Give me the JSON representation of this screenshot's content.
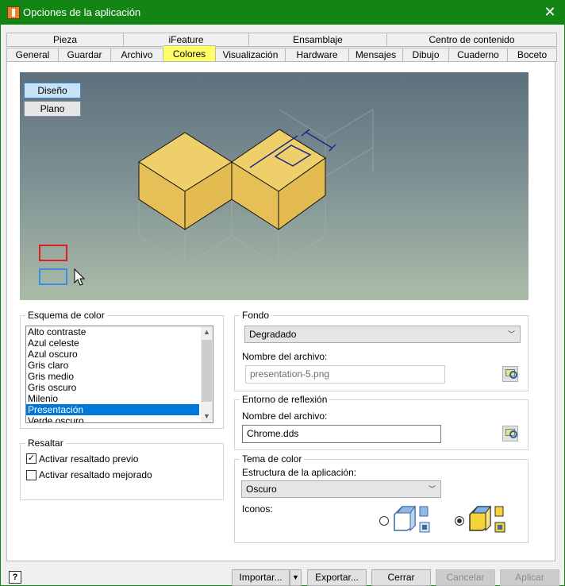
{
  "window": {
    "title": "Opciones de la aplicación"
  },
  "tabs_top": [
    "Pieza",
    "iFeature",
    "Ensamblaje",
    "Centro de contenido"
  ],
  "tabs_bottom": [
    "General",
    "Guardar",
    "Archivo",
    "Colores",
    "Visualización",
    "Hardware",
    "Mensajes",
    "Dibujo",
    "Cuaderno",
    "Boceto"
  ],
  "active_tab": "Colores",
  "preview": {
    "design_button": "Diseño",
    "flat_button": "Plano"
  },
  "color_scheme": {
    "label": "Esquema de color",
    "items": [
      "Alto contraste",
      "Azul celeste",
      "Azul oscuro",
      "Gris claro",
      "Gris medio",
      "Gris oscuro",
      "Milenio",
      "Presentación",
      "Verde oscuro"
    ],
    "selected": "Presentación"
  },
  "highlight": {
    "label": "Resaltar",
    "preview_highlight": {
      "label": "Activar resaltado previo",
      "checked": true
    },
    "enhanced_highlight": {
      "label": "Activar resaltado mejorado",
      "checked": false
    }
  },
  "background": {
    "label": "Fondo",
    "value": "Degradado",
    "filename_label": "Nombre del archivo:",
    "filename": "presentation-5.png"
  },
  "reflection": {
    "label": "Entorno de reflexión",
    "filename_label": "Nombre del archivo:",
    "filename": "Chrome.dds"
  },
  "color_theme": {
    "label": "Tema de color",
    "structure_label": "Estructura de la aplicación:",
    "structure_value": "Oscuro",
    "icons_label": "Iconos:",
    "selected_icon_option": 2
  },
  "buttons": {
    "help": "?",
    "import": "Importar...",
    "export": "Exportar...",
    "close": "Cerrar",
    "cancel": "Cancelar",
    "apply": "Aplicar"
  },
  "colors": {
    "titlebar": "#138515",
    "active_tab": "#ffff66",
    "model_face": "#e6bf57",
    "selection": "#0078d7"
  }
}
